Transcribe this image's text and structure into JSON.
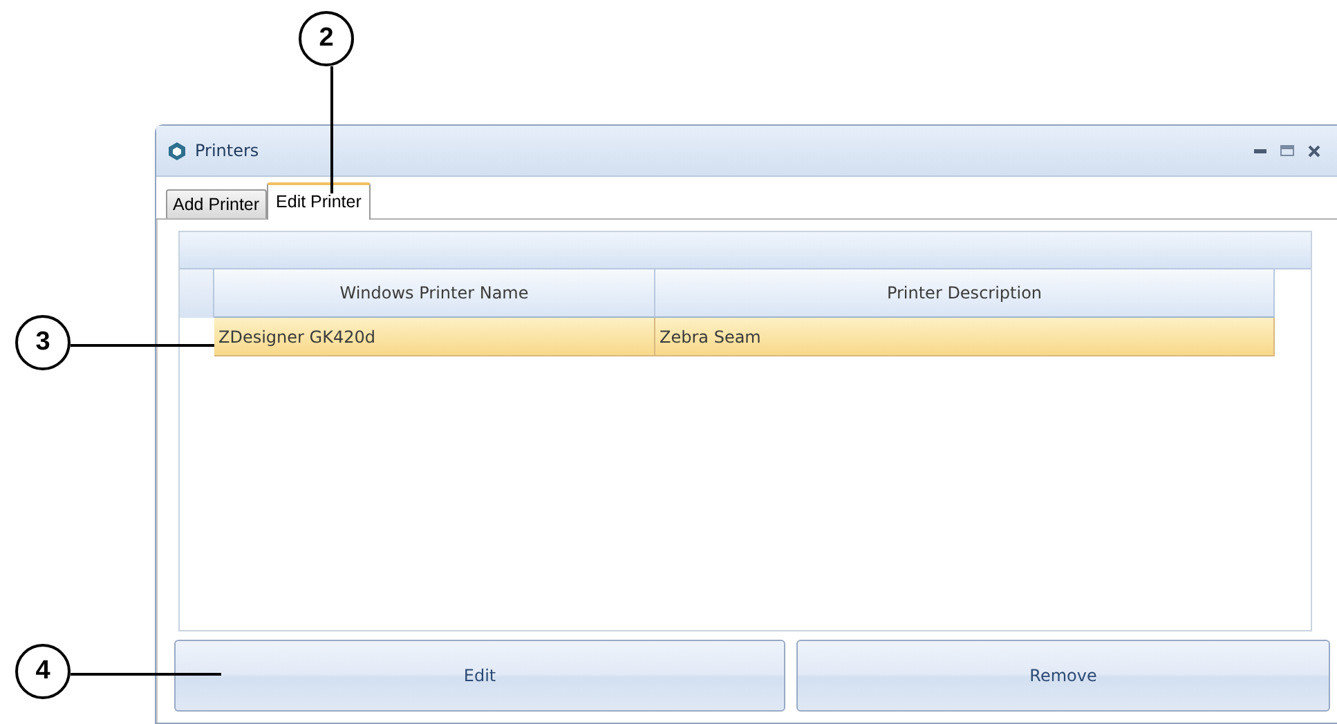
{
  "window": {
    "title": "Printers"
  },
  "tabs": [
    {
      "label": "Add Printer",
      "selected": false
    },
    {
      "label": "Edit Printer",
      "selected": true
    }
  ],
  "table": {
    "columns": [
      "Windows Printer Name",
      "Printer Description"
    ],
    "rows": [
      {
        "cells": [
          "ZDesigner GK420d",
          "Zebra Seam"
        ],
        "selected": true
      }
    ]
  },
  "buttons": [
    "Edit",
    "Remove"
  ],
  "callouts": [
    {
      "label": "2"
    },
    {
      "label": "3"
    },
    {
      "label": "4"
    }
  ]
}
